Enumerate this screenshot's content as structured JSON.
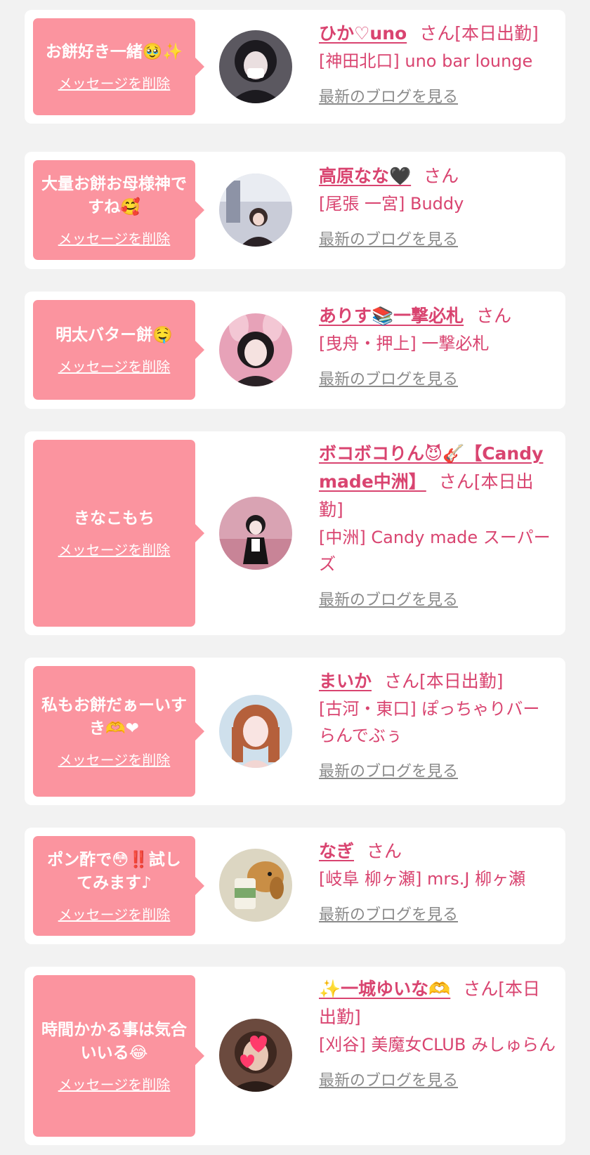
{
  "labels": {
    "delete": "メッセージを削除",
    "blog": "最新のブログを見る",
    "san": "さん"
  },
  "colors": {
    "bubble": "#fb949f",
    "accent": "#d94470",
    "link_gray": "#8a8a8a",
    "background": "#f2f2f2"
  },
  "entries": [
    {
      "message": "お餅好き一緒🥹✨",
      "name": "ひか♡uno",
      "suffix": "[本日出勤]",
      "shop": "[神田北口] uno bar lounge",
      "avatar_icon": "portrait-dark-hair"
    },
    {
      "message": "大量お餅お母様神ですね🥰",
      "name": "高原なな🖤",
      "suffix": "",
      "shop": "[尾張 一宮] Buddy",
      "avatar_icon": "portrait-room"
    },
    {
      "message": "明太バター餅🤤",
      "name": "ありす📚一撃必札",
      "suffix": "",
      "shop": "[曳舟・押上] 一撃必札",
      "avatar_icon": "portrait-bunny-ears"
    },
    {
      "message": "きなこもち",
      "name": "ボコボコりん😈🎸【Candy made中洲】",
      "suffix": "[本日出勤]",
      "shop": "[中洲] Candy made スーパーズ",
      "avatar_icon": "portrait-maid"
    },
    {
      "message": "私もお餅だぁーいすき🫶❤",
      "name": "まいか",
      "suffix": "[本日出勤]",
      "shop": "[古河・東口] ぽっちゃりバー らんでぶぅ",
      "avatar_icon": "portrait-auburn-hair"
    },
    {
      "message": "ポン酢で😳‼️試してみます♪",
      "name": "なぎ",
      "suffix": "",
      "shop": "[岐阜 柳ヶ瀬] mrs.J 柳ヶ瀬",
      "avatar_icon": "dog-with-drink"
    },
    {
      "message": "時間かかる事は気合いいる😂",
      "name": "✨一城ゆいな🫶",
      "suffix": "[本日出勤]",
      "shop": "[刈谷] 美魔女CLUB みしゅらん",
      "avatar_icon": "portrait-hearts-sticker"
    }
  ]
}
